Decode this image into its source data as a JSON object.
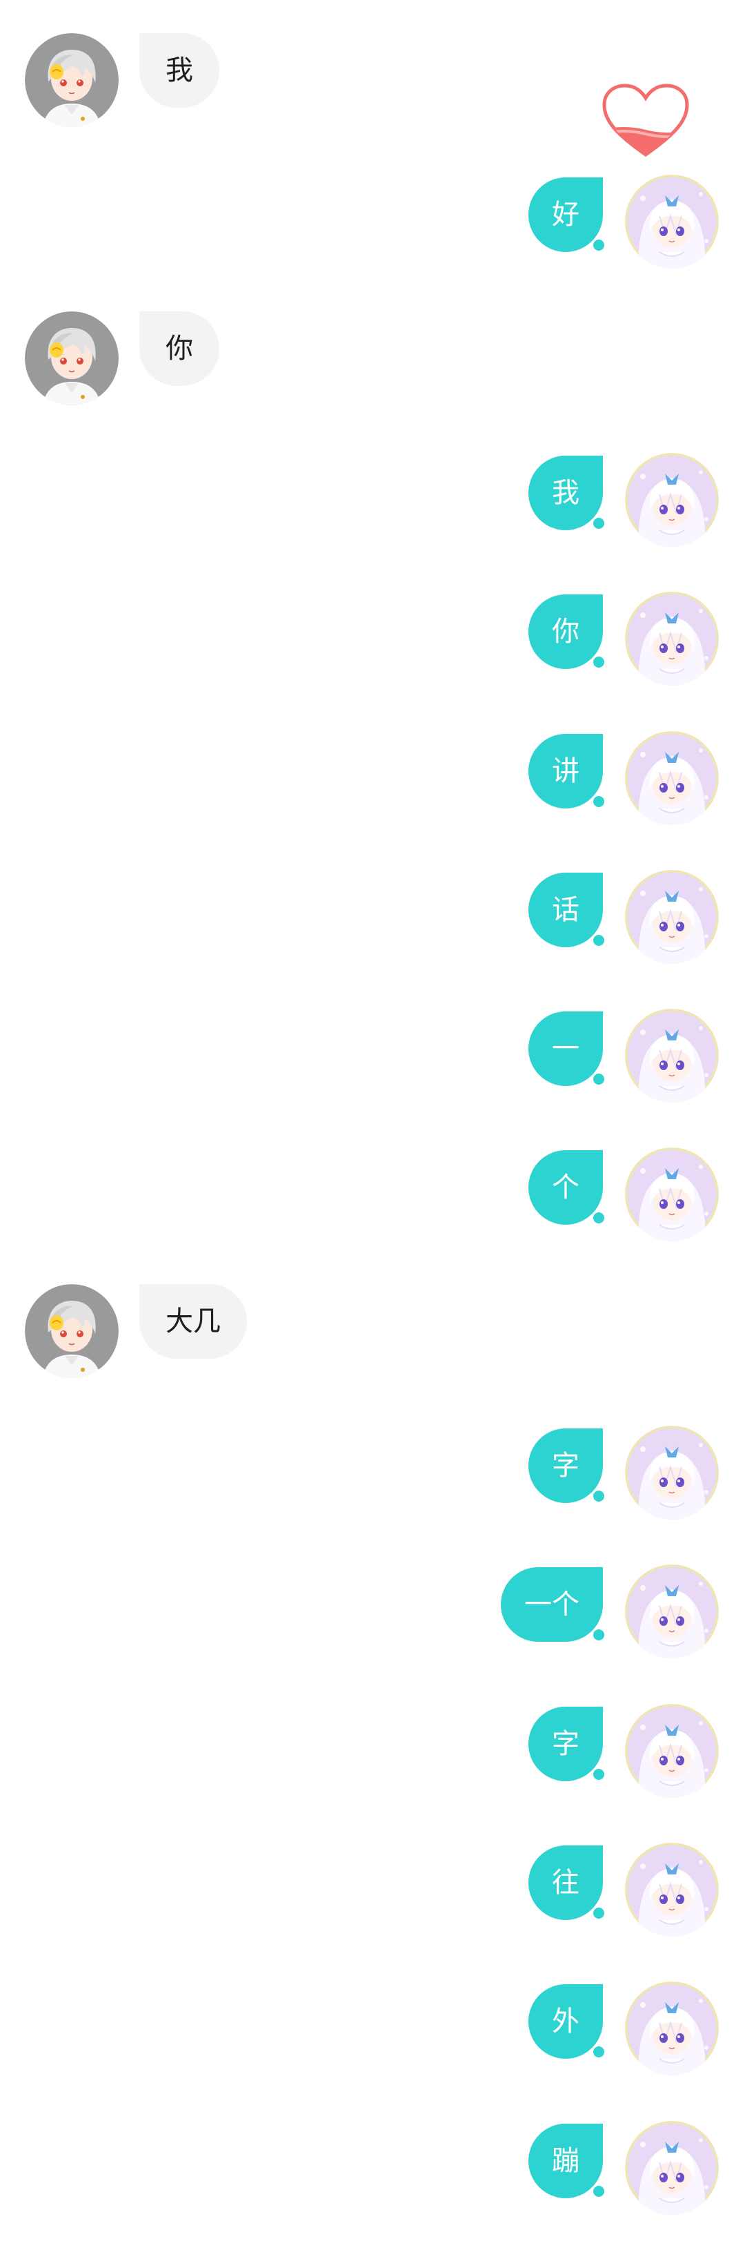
{
  "colors": {
    "outgoing_bubble": "#2dd3d1",
    "incoming_bubble": "#f3f3f3",
    "heart": "#f46d6d"
  },
  "icons": {
    "male_avatar": "grey-haired-boy-avatar",
    "female_avatar": "white-haired-girl-avatar",
    "heart": "heart-icon"
  },
  "messages": [
    {
      "side": "left",
      "text": "我"
    },
    {
      "side": "right",
      "text": "好"
    },
    {
      "side": "left",
      "text": "你"
    },
    {
      "side": "right",
      "text": "我"
    },
    {
      "side": "right",
      "text": "你"
    },
    {
      "side": "right",
      "text": "讲"
    },
    {
      "side": "right",
      "text": "话"
    },
    {
      "side": "right",
      "text": "一"
    },
    {
      "side": "right",
      "text": "个"
    },
    {
      "side": "left",
      "text": "大几"
    },
    {
      "side": "right",
      "text": "字"
    },
    {
      "side": "right",
      "text": "一个"
    },
    {
      "side": "right",
      "text": "字"
    },
    {
      "side": "right",
      "text": "往"
    },
    {
      "side": "right",
      "text": "外"
    },
    {
      "side": "right",
      "text": "蹦"
    }
  ]
}
